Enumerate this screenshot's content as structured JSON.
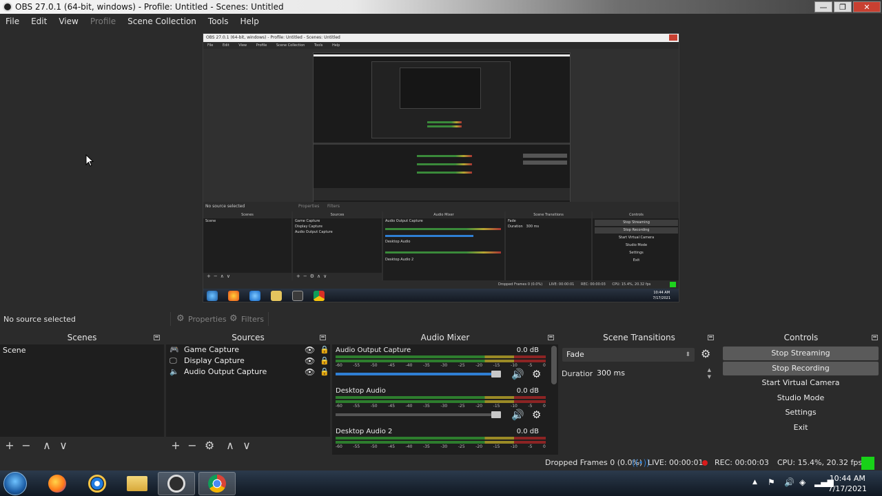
{
  "window": {
    "title": "OBS 27.0.1 (64-bit, windows) - Profile: Untitled - Scenes: Untitled",
    "minimize": "—",
    "maximize": "❐",
    "close": "✕"
  },
  "menu": {
    "file": "File",
    "edit": "Edit",
    "view": "View",
    "profile": "Profile",
    "scene_collection": "Scene Collection",
    "tools": "Tools",
    "help": "Help"
  },
  "preview": {
    "mini_title": "OBS 27.0.1 (64-bit, windows) - Profile: Untitled - Scenes: Untitled",
    "mini_menu": [
      "File",
      "Edit",
      "View",
      "Profile",
      "Scene Collection",
      "Tools",
      "Help"
    ],
    "mini_status": "No source selected",
    "mini_properties": "Properties",
    "mini_filters": "Filters",
    "mini_docks": {
      "scenes": "Scenes",
      "sources": "Sources",
      "mixer": "Audio Mixer",
      "transitions": "Scene Transitions",
      "controls": "Controls",
      "scene_item": "Scene",
      "source_items": [
        "Game Capture",
        "Display Capture",
        "Audio Output Capture"
      ],
      "mixer_items": [
        "Audio Output Capture",
        "Desktop Audio",
        "Desktop Audio 2"
      ],
      "transition_value": "Fade",
      "duration_label": "Duration",
      "duration_value": "300 ms",
      "control_items": [
        "Stop Streaming",
        "Stop Recording",
        "Start Virtual Camera",
        "Studio Mode",
        "Settings",
        "Exit"
      ]
    },
    "mini_dropped": "Dropped Frames 0 (0.0%)",
    "mini_live": "LIVE: 00:00:01",
    "mini_rec": "REC: 00:00:03",
    "mini_cpu": "CPU: 15.4%, 20.32 fps",
    "mini_clock_time": "10:44 AM",
    "mini_clock_date": "7/17/2021"
  },
  "selection_bar": {
    "no_source": "No source selected",
    "properties": "Properties",
    "filters": "Filters"
  },
  "scenes": {
    "title": "Scenes",
    "items": [
      "Scene"
    ],
    "footer": {
      "add": "+",
      "remove": "−",
      "up": "∧",
      "down": "∨"
    }
  },
  "sources": {
    "title": "Sources",
    "items": [
      {
        "name": "Game Capture",
        "icon": "gamepad-icon"
      },
      {
        "name": "Display Capture",
        "icon": "monitor-icon"
      },
      {
        "name": "Audio Output Capture",
        "icon": "speaker-icon"
      }
    ],
    "footer": {
      "add": "+",
      "remove": "−",
      "settings": "⚙",
      "up": "∧",
      "down": "∨"
    }
  },
  "mixer": {
    "title": "Audio Mixer",
    "ticks": [
      "-60",
      "-55",
      "-50",
      "-45",
      "-40",
      "-35",
      "-30",
      "-25",
      "-20",
      "-15",
      "-10",
      "-5",
      "0"
    ],
    "channels": [
      {
        "name": "Audio Output Capture",
        "db": "0.0 dB",
        "volume": 1.0
      },
      {
        "name": "Desktop Audio",
        "db": "0.0 dB",
        "volume": 1.0
      },
      {
        "name": "Desktop Audio 2",
        "db": "0.0 dB",
        "volume": 1.0
      }
    ],
    "colors": {
      "green": "#2d7d2d",
      "yellow": "#9a8a26",
      "red": "#8c2424",
      "slider": "#2f7fd4"
    }
  },
  "transitions": {
    "title": "Scene Transitions",
    "selected": "Fade",
    "duration_label": "Duration",
    "duration_value": "300 ms"
  },
  "controls": {
    "title": "Controls",
    "stop_streaming": "Stop Streaming",
    "stop_recording": "Stop Recording",
    "start_virtual_camera": "Start Virtual Camera",
    "studio_mode": "Studio Mode",
    "settings": "Settings",
    "exit": "Exit"
  },
  "status": {
    "dropped": "Dropped Frames 0 (0.0%)",
    "live": "LIVE: 00:00:01",
    "rec": "REC: 00:00:03",
    "cpu": "CPU: 15.4%, 20.32 fps",
    "indicator_color": "#18d218"
  },
  "taskbar": {
    "apps": [
      "windows-start",
      "firefox",
      "internet-explorer",
      "file-explorer",
      "obs-studio",
      "chrome"
    ],
    "clock_time": "10:44 AM",
    "clock_date": "7/17/2021"
  }
}
